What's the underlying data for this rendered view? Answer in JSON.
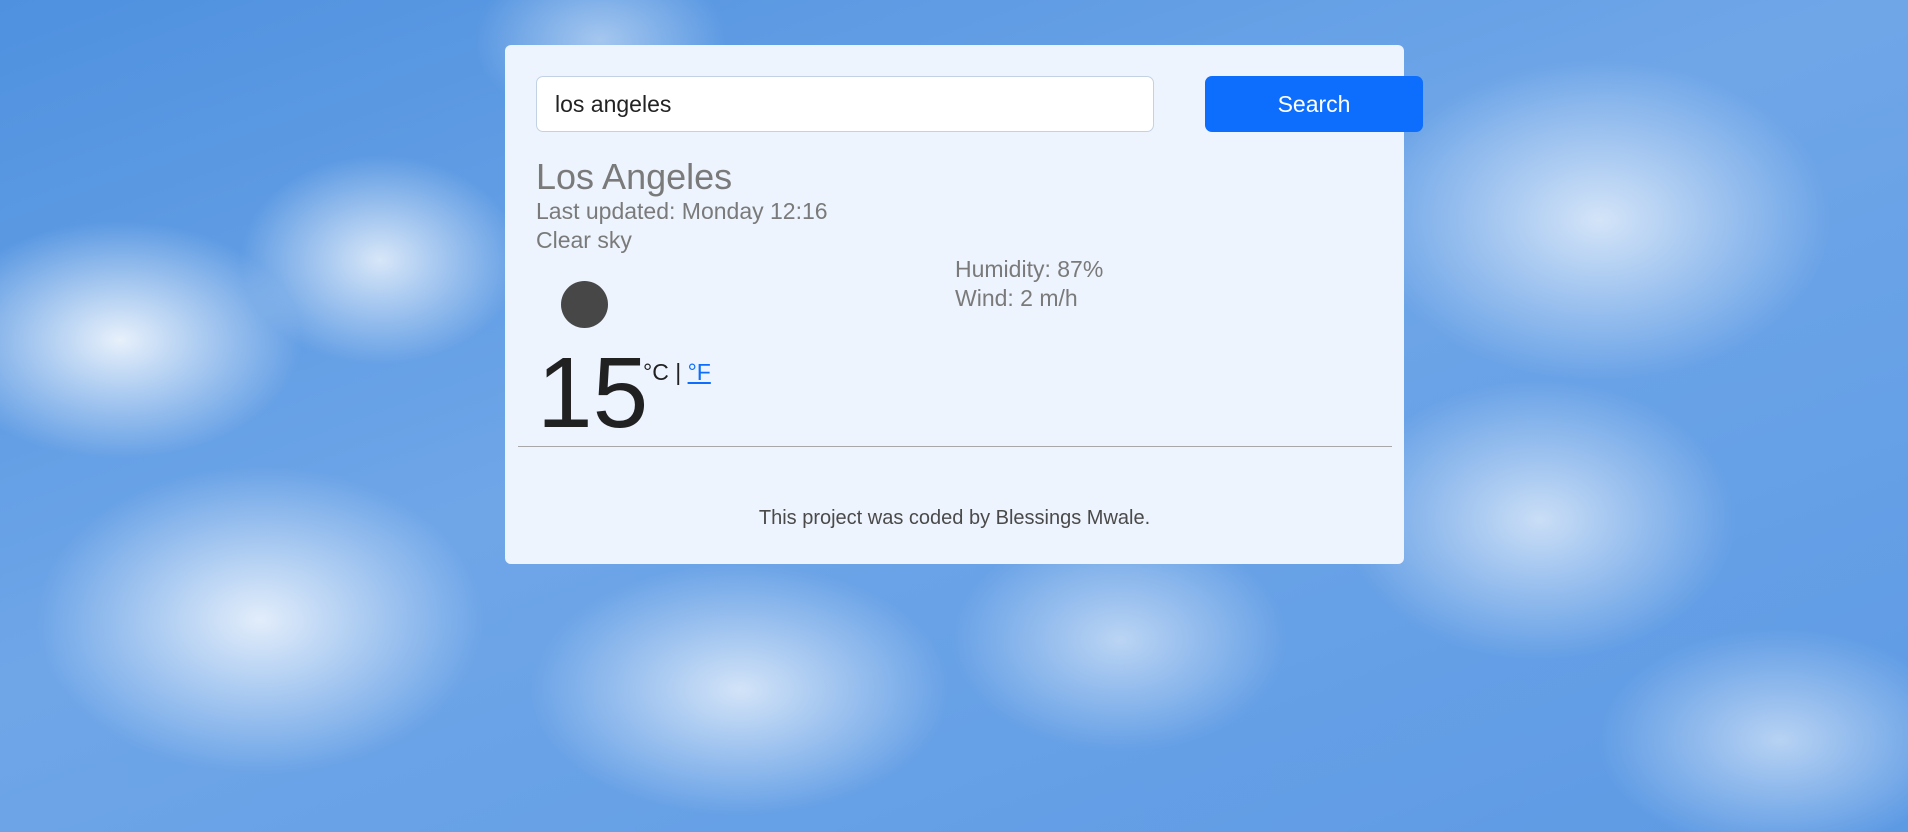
{
  "search": {
    "value": "los angeles",
    "button_label": "Search"
  },
  "weather": {
    "city": "Los Angeles",
    "last_updated": "Last updated: Monday 12:16",
    "description": "Clear sky",
    "icon": "weather-icon",
    "temperature": "15",
    "unit_celsius": "°C",
    "unit_separator": " | ",
    "unit_fahrenheit": "°F",
    "humidity": "Humidity: 87%",
    "wind": "Wind: 2 m/h"
  },
  "footer": {
    "text": "This project was coded by Blessings Mwale."
  },
  "colors": {
    "accent": "#0d6efd",
    "card_background": "#edf4fd",
    "icon_color": "#474747"
  }
}
